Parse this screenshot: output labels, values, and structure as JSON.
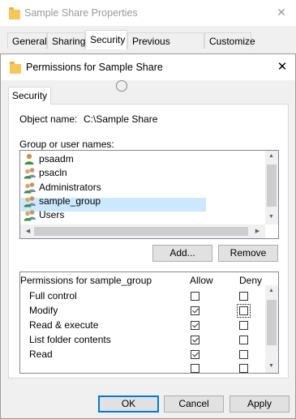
{
  "back_window": {
    "title": "Sample Share Properties",
    "tabs": [
      "General",
      "Sharing",
      "Security",
      "Previous Versions",
      "Customize"
    ],
    "active_tab": "Security"
  },
  "dialog": {
    "title": "Permissions for Sample Share",
    "tab": "Security",
    "object_name_label": "Object name:",
    "object_name_value": "C:\\Sample Share",
    "group_label": "Group or user names:",
    "users": [
      {
        "name": "psaadm",
        "icon": "single-user-icon",
        "selected": false
      },
      {
        "name": "psacln",
        "icon": "group-icon",
        "selected": false
      },
      {
        "name": "Administrators",
        "icon": "group-icon",
        "selected": false
      },
      {
        "name": "sample_group",
        "icon": "group-icon",
        "selected": true
      },
      {
        "name": "Users",
        "icon": "group-icon",
        "selected": false
      }
    ],
    "add_label": "Add...",
    "remove_label": "Remove",
    "permissions_header": "Permissions for sample_group",
    "allow_label": "Allow",
    "deny_label": "Deny",
    "permissions": [
      {
        "name": "Full control",
        "allow": false,
        "deny": false
      },
      {
        "name": "Modify",
        "allow": true,
        "deny": false
      },
      {
        "name": "Read & execute",
        "allow": true,
        "deny": false
      },
      {
        "name": "List folder contents",
        "allow": true,
        "deny": false
      },
      {
        "name": "Read",
        "allow": true,
        "deny": false
      }
    ],
    "ok_label": "OK",
    "cancel_label": "Cancel",
    "apply_label": "Apply",
    "close_glyph": "✕",
    "colors": {
      "accent": "#0078d7",
      "selection": "#cce8ff",
      "folder": "#f5c75a"
    }
  }
}
